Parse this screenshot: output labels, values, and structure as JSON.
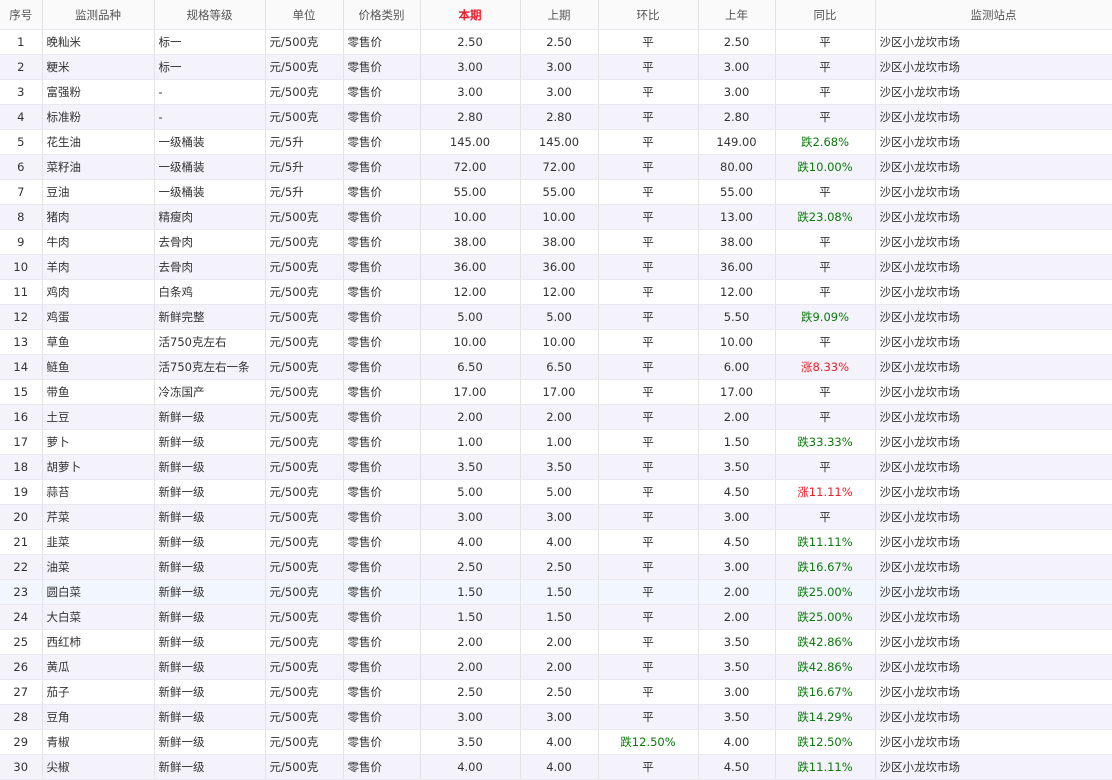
{
  "headers": [
    "序号",
    "监测品种",
    "规格等级",
    "单位",
    "价格类别",
    "本期",
    "上期",
    "环比",
    "上年",
    "同比",
    "监测站点"
  ],
  "colors": {
    "current_period_header": "#e8202d",
    "decrease": "#0a7a0a",
    "increase": "#e8202d"
  },
  "rows": [
    {
      "no": "1",
      "item": "晚籼米",
      "grade": "标一",
      "unit": "元/500克",
      "type": "零售价",
      "cur": "2.50",
      "prev": "2.50",
      "mom": "平",
      "lastyear": "2.50",
      "yoy": "平",
      "station": "沙区小龙坎市场"
    },
    {
      "no": "2",
      "item": "粳米",
      "grade": "标一",
      "unit": "元/500克",
      "type": "零售价",
      "cur": "3.00",
      "prev": "3.00",
      "mom": "平",
      "lastyear": "3.00",
      "yoy": "平",
      "station": "沙区小龙坎市场"
    },
    {
      "no": "3",
      "item": "富强粉",
      "grade": "-",
      "unit": "元/500克",
      "type": "零售价",
      "cur": "3.00",
      "prev": "3.00",
      "mom": "平",
      "lastyear": "3.00",
      "yoy": "平",
      "station": "沙区小龙坎市场"
    },
    {
      "no": "4",
      "item": "标准粉",
      "grade": "-",
      "unit": "元/500克",
      "type": "零售价",
      "cur": "2.80",
      "prev": "2.80",
      "mom": "平",
      "lastyear": "2.80",
      "yoy": "平",
      "station": "沙区小龙坎市场"
    },
    {
      "no": "5",
      "item": "花生油",
      "grade": "一级桶装",
      "unit": "元/5升",
      "type": "零售价",
      "cur": "145.00",
      "prev": "145.00",
      "mom": "平",
      "lastyear": "149.00",
      "yoy": "跌2.68%",
      "station": "沙区小龙坎市场"
    },
    {
      "no": "6",
      "item": "菜籽油",
      "grade": "一级桶装",
      "unit": "元/5升",
      "type": "零售价",
      "cur": "72.00",
      "prev": "72.00",
      "mom": "平",
      "lastyear": "80.00",
      "yoy": "跌10.00%",
      "station": "沙区小龙坎市场"
    },
    {
      "no": "7",
      "item": "豆油",
      "grade": "一级桶装",
      "unit": "元/5升",
      "type": "零售价",
      "cur": "55.00",
      "prev": "55.00",
      "mom": "平",
      "lastyear": "55.00",
      "yoy": "平",
      "station": "沙区小龙坎市场"
    },
    {
      "no": "8",
      "item": "猪肉",
      "grade": "精瘦肉",
      "unit": "元/500克",
      "type": "零售价",
      "cur": "10.00",
      "prev": "10.00",
      "mom": "平",
      "lastyear": "13.00",
      "yoy": "跌23.08%",
      "station": "沙区小龙坎市场"
    },
    {
      "no": "9",
      "item": "牛肉",
      "grade": "去骨肉",
      "unit": "元/500克",
      "type": "零售价",
      "cur": "38.00",
      "prev": "38.00",
      "mom": "平",
      "lastyear": "38.00",
      "yoy": "平",
      "station": "沙区小龙坎市场"
    },
    {
      "no": "10",
      "item": "羊肉",
      "grade": "去骨肉",
      "unit": "元/500克",
      "type": "零售价",
      "cur": "36.00",
      "prev": "36.00",
      "mom": "平",
      "lastyear": "36.00",
      "yoy": "平",
      "station": "沙区小龙坎市场"
    },
    {
      "no": "11",
      "item": "鸡肉",
      "grade": "白条鸡",
      "unit": "元/500克",
      "type": "零售价",
      "cur": "12.00",
      "prev": "12.00",
      "mom": "平",
      "lastyear": "12.00",
      "yoy": "平",
      "station": "沙区小龙坎市场"
    },
    {
      "no": "12",
      "item": "鸡蛋",
      "grade": "新鲜完整",
      "unit": "元/500克",
      "type": "零售价",
      "cur": "5.00",
      "prev": "5.00",
      "mom": "平",
      "lastyear": "5.50",
      "yoy": "跌9.09%",
      "station": "沙区小龙坎市场"
    },
    {
      "no": "13",
      "item": "草鱼",
      "grade": "活750克左右",
      "unit": "元/500克",
      "type": "零售价",
      "cur": "10.00",
      "prev": "10.00",
      "mom": "平",
      "lastyear": "10.00",
      "yoy": "平",
      "station": "沙区小龙坎市场"
    },
    {
      "no": "14",
      "item": "鲢鱼",
      "grade": "活750克左右一条",
      "unit": "元/500克",
      "type": "零售价",
      "cur": "6.50",
      "prev": "6.50",
      "mom": "平",
      "lastyear": "6.00",
      "yoy": "涨8.33%",
      "station": "沙区小龙坎市场"
    },
    {
      "no": "15",
      "item": "带鱼",
      "grade": "冷冻国产",
      "unit": "元/500克",
      "type": "零售价",
      "cur": "17.00",
      "prev": "17.00",
      "mom": "平",
      "lastyear": "17.00",
      "yoy": "平",
      "station": "沙区小龙坎市场"
    },
    {
      "no": "16",
      "item": "土豆",
      "grade": "新鲜一级",
      "unit": "元/500克",
      "type": "零售价",
      "cur": "2.00",
      "prev": "2.00",
      "mom": "平",
      "lastyear": "2.00",
      "yoy": "平",
      "station": "沙区小龙坎市场"
    },
    {
      "no": "17",
      "item": "萝卜",
      "grade": "新鲜一级",
      "unit": "元/500克",
      "type": "零售价",
      "cur": "1.00",
      "prev": "1.00",
      "mom": "平",
      "lastyear": "1.50",
      "yoy": "跌33.33%",
      "station": "沙区小龙坎市场"
    },
    {
      "no": "18",
      "item": "胡萝卜",
      "grade": "新鲜一级",
      "unit": "元/500克",
      "type": "零售价",
      "cur": "3.50",
      "prev": "3.50",
      "mom": "平",
      "lastyear": "3.50",
      "yoy": "平",
      "station": "沙区小龙坎市场"
    },
    {
      "no": "19",
      "item": "蒜苔",
      "grade": "新鲜一级",
      "unit": "元/500克",
      "type": "零售价",
      "cur": "5.00",
      "prev": "5.00",
      "mom": "平",
      "lastyear": "4.50",
      "yoy": "涨11.11%",
      "station": "沙区小龙坎市场"
    },
    {
      "no": "20",
      "item": "芹菜",
      "grade": "新鲜一级",
      "unit": "元/500克",
      "type": "零售价",
      "cur": "3.00",
      "prev": "3.00",
      "mom": "平",
      "lastyear": "3.00",
      "yoy": "平",
      "station": "沙区小龙坎市场"
    },
    {
      "no": "21",
      "item": "韭菜",
      "grade": "新鲜一级",
      "unit": "元/500克",
      "type": "零售价",
      "cur": "4.00",
      "prev": "4.00",
      "mom": "平",
      "lastyear": "4.50",
      "yoy": "跌11.11%",
      "station": "沙区小龙坎市场"
    },
    {
      "no": "22",
      "item": "油菜",
      "grade": "新鲜一级",
      "unit": "元/500克",
      "type": "零售价",
      "cur": "2.50",
      "prev": "2.50",
      "mom": "平",
      "lastyear": "3.00",
      "yoy": "跌16.67%",
      "station": "沙区小龙坎市场"
    },
    {
      "no": "23",
      "item": "圆白菜",
      "grade": "新鲜一级",
      "unit": "元/500克",
      "type": "零售价",
      "cur": "1.50",
      "prev": "1.50",
      "mom": "平",
      "lastyear": "2.00",
      "yoy": "跌25.00%",
      "station": "沙区小龙坎市场"
    },
    {
      "no": "24",
      "item": "大白菜",
      "grade": "新鲜一级",
      "unit": "元/500克",
      "type": "零售价",
      "cur": "1.50",
      "prev": "1.50",
      "mom": "平",
      "lastyear": "2.00",
      "yoy": "跌25.00%",
      "station": "沙区小龙坎市场"
    },
    {
      "no": "25",
      "item": "西红柿",
      "grade": "新鲜一级",
      "unit": "元/500克",
      "type": "零售价",
      "cur": "2.00",
      "prev": "2.00",
      "mom": "平",
      "lastyear": "3.50",
      "yoy": "跌42.86%",
      "station": "沙区小龙坎市场"
    },
    {
      "no": "26",
      "item": "黄瓜",
      "grade": "新鲜一级",
      "unit": "元/500克",
      "type": "零售价",
      "cur": "2.00",
      "prev": "2.00",
      "mom": "平",
      "lastyear": "3.50",
      "yoy": "跌42.86%",
      "station": "沙区小龙坎市场"
    },
    {
      "no": "27",
      "item": "茄子",
      "grade": "新鲜一级",
      "unit": "元/500克",
      "type": "零售价",
      "cur": "2.50",
      "prev": "2.50",
      "mom": "平",
      "lastyear": "3.00",
      "yoy": "跌16.67%",
      "station": "沙区小龙坎市场"
    },
    {
      "no": "28",
      "item": "豆角",
      "grade": "新鲜一级",
      "unit": "元/500克",
      "type": "零售价",
      "cur": "3.00",
      "prev": "3.00",
      "mom": "平",
      "lastyear": "3.50",
      "yoy": "跌14.29%",
      "station": "沙区小龙坎市场"
    },
    {
      "no": "29",
      "item": "青椒",
      "grade": "新鲜一级",
      "unit": "元/500克",
      "type": "零售价",
      "cur": "3.50",
      "prev": "4.00",
      "mom": "跌12.50%",
      "lastyear": "4.00",
      "yoy": "跌12.50%",
      "station": "沙区小龙坎市场"
    },
    {
      "no": "30",
      "item": "尖椒",
      "grade": "新鲜一级",
      "unit": "元/500克",
      "type": "零售价",
      "cur": "4.00",
      "prev": "4.00",
      "mom": "平",
      "lastyear": "4.50",
      "yoy": "跌11.11%",
      "station": "沙区小龙坎市场"
    }
  ]
}
